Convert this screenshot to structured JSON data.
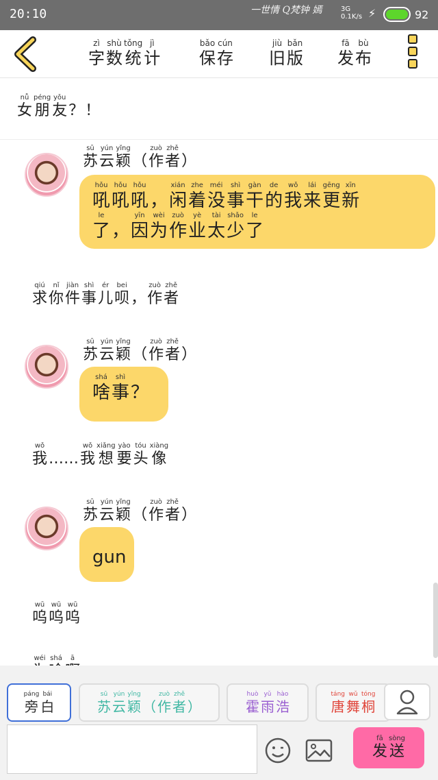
{
  "status_bar": {
    "time": "20:10",
    "decoration": "一世情 Q梵钟 嫣",
    "network": "3G",
    "speed": "0.1K/s",
    "battery": "92"
  },
  "toolbar": {
    "items": [
      {
        "label": [
          [
            "zì",
            "字"
          ],
          [
            "shù",
            "数"
          ],
          [
            "tǒng",
            "统"
          ],
          [
            "jì",
            "计"
          ]
        ]
      },
      {
        "label": [
          [
            "bǎo",
            "保"
          ],
          [
            "cún",
            "存"
          ]
        ]
      },
      {
        "label": [
          [
            "jiù",
            "旧"
          ],
          [
            "bǎn",
            "版"
          ]
        ]
      },
      {
        "label": [
          [
            "fā",
            "发"
          ],
          [
            "bù",
            "布"
          ]
        ]
      }
    ]
  },
  "chat": {
    "items": [
      {
        "type": "narration",
        "text": [
          [
            "nǚ",
            "女"
          ],
          [
            "péng",
            "朋"
          ],
          [
            "yǒu",
            "友"
          ],
          [
            "",
            "？"
          ],
          [
            "",
            "！"
          ]
        ]
      },
      {
        "type": "message",
        "name": [
          [
            "sū",
            "苏"
          ],
          [
            "yún",
            "云"
          ],
          [
            "yǐng",
            "颖"
          ],
          [
            "",
            "（"
          ],
          [
            "zuò",
            "作"
          ],
          [
            "zhě",
            "者"
          ],
          [
            "",
            "）"
          ]
        ],
        "lines": [
          [
            [
              "hǒu",
              "吼"
            ],
            [
              "hǒu",
              "吼"
            ],
            [
              "hǒu",
              "吼"
            ],
            [
              "",
              "，"
            ],
            [
              "xián",
              "闲"
            ],
            [
              "zhe",
              "着"
            ],
            [
              "méi",
              "没"
            ],
            [
              "shì",
              "事"
            ],
            [
              "gàn",
              "干"
            ],
            [
              "de",
              "的"
            ],
            [
              "wǒ",
              "我"
            ],
            [
              "lái",
              "来"
            ],
            [
              "gēng",
              "更"
            ],
            [
              "xīn",
              "新"
            ]
          ],
          [
            [
              "le",
              "了"
            ],
            [
              "",
              "，"
            ],
            [
              "yīn",
              "因"
            ],
            [
              "wèi",
              "为"
            ],
            [
              "zuò",
              "作"
            ],
            [
              "yè",
              "业"
            ],
            [
              "tài",
              "太"
            ],
            [
              "shǎo",
              "少"
            ],
            [
              "le",
              "了"
            ]
          ]
        ]
      },
      {
        "type": "narration",
        "text": [
          [
            "qiú",
            "求"
          ],
          [
            "nǐ",
            "你"
          ],
          [
            "jiàn",
            "件"
          ],
          [
            "shì",
            "事"
          ],
          [
            "ér",
            "儿"
          ],
          [
            "bei",
            "呗"
          ],
          [
            "",
            "，"
          ],
          [
            "zuò",
            "作"
          ],
          [
            "zhě",
            "者"
          ]
        ]
      },
      {
        "type": "message",
        "name": [
          [
            "sū",
            "苏"
          ],
          [
            "yún",
            "云"
          ],
          [
            "yǐng",
            "颖"
          ],
          [
            "",
            "（"
          ],
          [
            "zuò",
            "作"
          ],
          [
            "zhě",
            "者"
          ],
          [
            "",
            "）"
          ]
        ],
        "lines": [
          [
            [
              "shá",
              "啥"
            ],
            [
              "shì",
              "事"
            ],
            [
              "",
              "？"
            ]
          ]
        ]
      },
      {
        "type": "narration",
        "text": [
          [
            "wǒ",
            "我"
          ],
          [
            "",
            "……"
          ],
          [
            "wǒ",
            "我"
          ],
          [
            "xiǎng",
            "想"
          ],
          [
            "yào",
            "要"
          ],
          [
            "tóu",
            "头"
          ],
          [
            "xiàng",
            "像"
          ]
        ]
      },
      {
        "type": "message",
        "name": [
          [
            "sū",
            "苏"
          ],
          [
            "yún",
            "云"
          ],
          [
            "yǐng",
            "颖"
          ],
          [
            "",
            "（"
          ],
          [
            "zuò",
            "作"
          ],
          [
            "zhě",
            "者"
          ],
          [
            "",
            "）"
          ]
        ],
        "lines": [
          [
            [
              "",
              "gun"
            ]
          ]
        ]
      },
      {
        "type": "narration",
        "text": [
          [
            "wū",
            "呜"
          ],
          [
            "wū",
            "呜"
          ],
          [
            "wū",
            "呜"
          ]
        ]
      },
      {
        "type": "narration",
        "text": [
          [
            "wéi",
            "为"
          ],
          [
            "shá",
            "啥"
          ],
          [
            "ā",
            "啊"
          ]
        ]
      }
    ]
  },
  "characters": [
    {
      "label": [
        [
          "páng",
          "旁"
        ],
        [
          "bái",
          "白"
        ]
      ],
      "color": "#333333"
    },
    {
      "label": [
        [
          "sū",
          "苏"
        ],
        [
          "yún",
          "云"
        ],
        [
          "yǐng",
          "颖"
        ],
        [
          "",
          "（"
        ],
        [
          "zuò",
          "作"
        ],
        [
          "zhě",
          "者"
        ],
        [
          "",
          "）"
        ]
      ],
      "color": "#3fb7a3"
    },
    {
      "label": [
        [
          "huò",
          "霍"
        ],
        [
          "yǔ",
          "雨"
        ],
        [
          "hào",
          "浩"
        ]
      ],
      "color": "#9a5fd1"
    },
    {
      "label": [
        [
          "táng",
          "唐"
        ],
        [
          "wǔ",
          "舞"
        ],
        [
          "tóng",
          "桐"
        ]
      ],
      "color": "#e0453a"
    }
  ],
  "send": {
    "label": [
      [
        "fā",
        "发"
      ],
      [
        "sòng",
        "送"
      ]
    ]
  },
  "colors": {
    "bubble": "#fcd76a",
    "send": "#ff6aa6",
    "status_bar": "#6e6e6e",
    "active_chip": "#3f6fd8"
  },
  "icons": [
    "back-chevron-icon",
    "menu-icon",
    "user-icon",
    "emoji-icon",
    "image-icon"
  ]
}
